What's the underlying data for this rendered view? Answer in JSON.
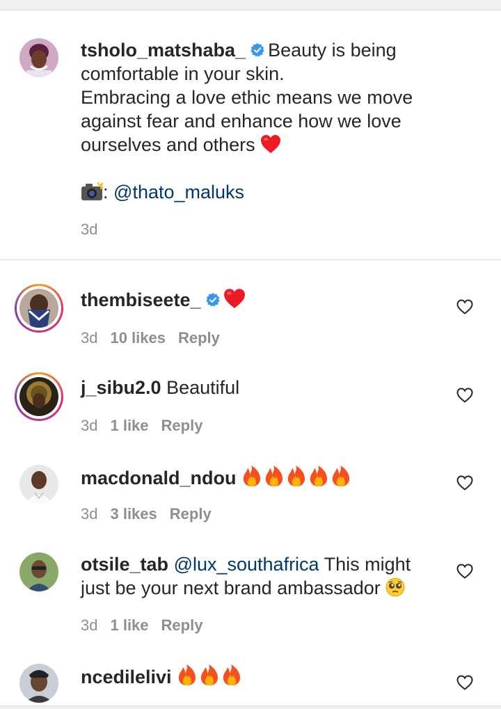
{
  "caption": {
    "username": "tsholo_matshaba_",
    "line1": "Beauty is being",
    "line2": "comfortable in your skin.",
    "line3": "Embracing a love ethic means we move",
    "line4": "against fear and enhance how we love",
    "line5": "ourselves and others",
    "credit_colon": ":",
    "credit_mention": "@thato_maluks",
    "time": "3d"
  },
  "comments": [
    {
      "username": "thembiseete_",
      "verified": true,
      "text": "",
      "emojis": [
        "red-heart"
      ],
      "time": "3d",
      "likes": "10 likes",
      "reply": "Reply"
    },
    {
      "username": "j_sibu2.0",
      "text": "Beautiful",
      "time": "3d",
      "likes": "1 like",
      "reply": "Reply"
    },
    {
      "username": "macdonald_ndou",
      "text": "",
      "emojis": [
        "fire",
        "fire",
        "fire",
        "fire",
        "fire"
      ],
      "time": "3d",
      "likes": "3 likes",
      "reply": "Reply"
    },
    {
      "username": "otsile_tab",
      "mention": "@lux_southafrica",
      "text_line1": "This might",
      "text_line2": "just be your next brand ambassador",
      "emojis": [
        "pleading-face"
      ],
      "time": "3d",
      "likes": "1 like",
      "reply": "Reply"
    },
    {
      "username": "ncedilelivi",
      "text": "",
      "emojis": [
        "fire",
        "fire",
        "fire"
      ]
    }
  ],
  "colors": {
    "text": "#262626",
    "meta": "#8e8e8e",
    "mention": "#00376b",
    "verified": "#3897f0",
    "heart": "#ed1c24"
  },
  "icons": [
    "verified-badge-icon",
    "camera-flash-icon",
    "heart-outline-icon",
    "red-heart-emoji",
    "fire-emoji",
    "pleading-face-emoji"
  ]
}
